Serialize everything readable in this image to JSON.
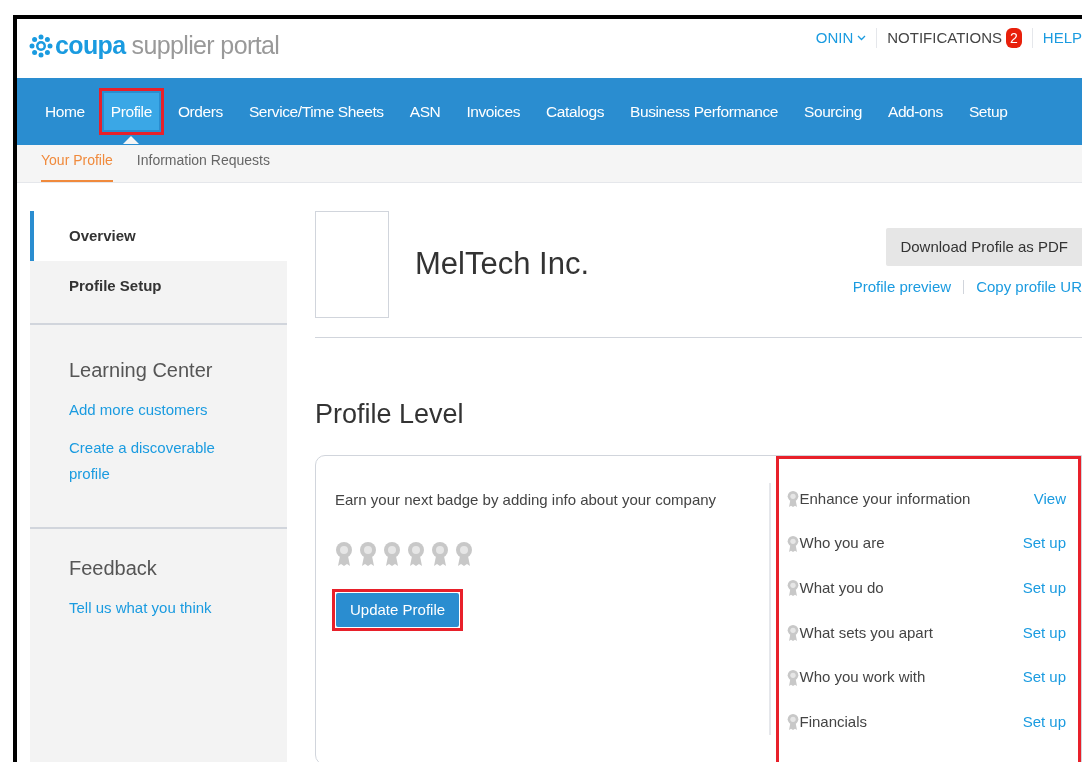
{
  "header": {
    "logo_brand": "coupa",
    "logo_product": "supplier portal",
    "user_menu": "ONIN",
    "notifications": {
      "label": "NOTIFICATIONS",
      "count": "2"
    },
    "help": "HELP"
  },
  "nav": [
    {
      "label": "Home",
      "selected": false,
      "highlighted": false
    },
    {
      "label": "Profile",
      "selected": true,
      "highlighted": true
    },
    {
      "label": "Orders",
      "selected": false,
      "highlighted": false
    },
    {
      "label": "Service/Time Sheets",
      "selected": false,
      "highlighted": false
    },
    {
      "label": "ASN",
      "selected": false,
      "highlighted": false
    },
    {
      "label": "Invoices",
      "selected": false,
      "highlighted": false
    },
    {
      "label": "Catalogs",
      "selected": false,
      "highlighted": false
    },
    {
      "label": "Business Performance",
      "selected": false,
      "highlighted": false
    },
    {
      "label": "Sourcing",
      "selected": false,
      "highlighted": false
    },
    {
      "label": "Add-ons",
      "selected": false,
      "highlighted": false
    },
    {
      "label": "Setup",
      "selected": false,
      "highlighted": false
    }
  ],
  "subnav": [
    {
      "label": "Your Profile",
      "selected": true
    },
    {
      "label": "Information Requests",
      "selected": false
    }
  ],
  "sidebar": {
    "items": [
      {
        "label": "Overview",
        "selected": true
      },
      {
        "label": "Profile Setup",
        "selected": false
      }
    ],
    "sections": [
      {
        "title": "Learning Center",
        "links": [
          "Add more customers",
          "Create a discoverable profile"
        ]
      },
      {
        "title": "Feedback",
        "links": [
          "Tell us what you think"
        ]
      }
    ]
  },
  "profile": {
    "company": "MelTech Inc.",
    "download_button": "Download Profile as PDF",
    "links": [
      "Profile preview",
      "Copy profile UR"
    ]
  },
  "profile_level": {
    "title": "Profile Level",
    "prompt": "Earn your next badge by adding info about your company",
    "badges": [
      {
        "earned": false
      },
      {
        "earned": false
      },
      {
        "earned": false
      },
      {
        "earned": false
      },
      {
        "earned": false
      },
      {
        "earned": false
      }
    ],
    "update_button": {
      "label": "Update Profile",
      "highlighted": true
    },
    "tasks_highlighted": true,
    "tasks": [
      {
        "label": "Enhance your information",
        "action": "View",
        "done": false
      },
      {
        "label": "Who you are",
        "action": "Set up",
        "done": false
      },
      {
        "label": "What you do",
        "action": "Set up",
        "done": false
      },
      {
        "label": "What sets you apart",
        "action": "Set up",
        "done": false
      },
      {
        "label": "Who you work with",
        "action": "Set up",
        "done": false
      },
      {
        "label": "Financials",
        "action": "Set up",
        "done": false
      }
    ]
  }
}
